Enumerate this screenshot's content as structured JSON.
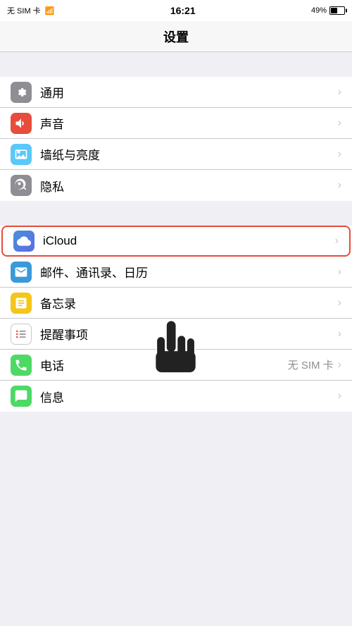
{
  "statusBar": {
    "left": "无 SIM 卡  ✦",
    "time": "16:21",
    "battery": "49%"
  },
  "header": {
    "title": "设置"
  },
  "groups": [
    {
      "id": "group1",
      "items": [
        {
          "id": "general",
          "label": "通用",
          "iconColor": "gray",
          "iconType": "gear"
        },
        {
          "id": "sound",
          "label": "声音",
          "iconColor": "red",
          "iconType": "sound"
        },
        {
          "id": "wallpaper",
          "label": "墙纸与亮度",
          "iconColor": "blue-light",
          "iconType": "wallpaper"
        },
        {
          "id": "privacy",
          "label": "隐私",
          "iconColor": "gray-dark",
          "iconType": "privacy"
        }
      ]
    },
    {
      "id": "group2",
      "items": [
        {
          "id": "icloud",
          "label": "iCloud",
          "iconColor": "icloud",
          "iconType": "cloud",
          "highlighted": true
        },
        {
          "id": "mail",
          "label": "邮件、通讯录、日历",
          "iconColor": "mail",
          "iconType": "mail"
        },
        {
          "id": "notes",
          "label": "备忘录",
          "iconColor": "notes",
          "iconType": "notes"
        },
        {
          "id": "reminders",
          "label": "提醒事项",
          "iconColor": "reminders",
          "iconType": "reminders"
        },
        {
          "id": "phone",
          "label": "电话",
          "iconColor": "phone",
          "iconType": "phone",
          "value": "无 SIM 卡"
        },
        {
          "id": "messages",
          "label": "信息",
          "iconColor": "messages",
          "iconType": "messages"
        }
      ]
    }
  ]
}
